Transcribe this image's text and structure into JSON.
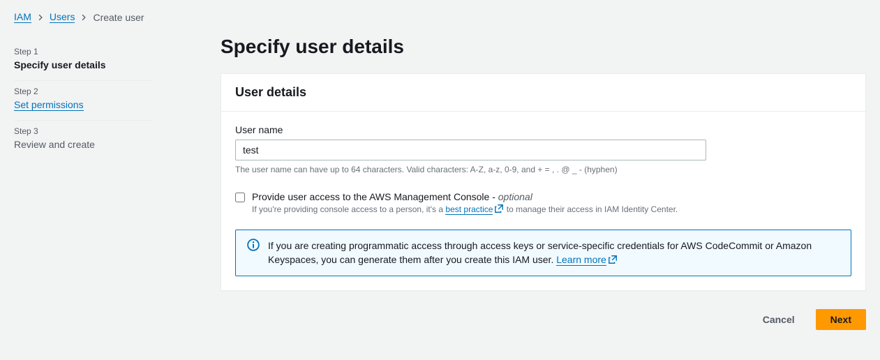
{
  "breadcrumb": {
    "items": [
      "IAM",
      "Users",
      "Create user"
    ]
  },
  "sidebar": {
    "steps": [
      {
        "num": "Step 1",
        "title": "Specify user details"
      },
      {
        "num": "Step 2",
        "title": "Set permissions"
      },
      {
        "num": "Step 3",
        "title": "Review and create"
      }
    ]
  },
  "page": {
    "title": "Specify user details"
  },
  "panel": {
    "title": "User details",
    "username_label": "User name",
    "username_value": "test",
    "username_hint": "The user name can have up to 64 characters. Valid characters: A-Z, a-z, 0-9, and + = , . @ _ - (hyphen)",
    "checkbox_label_main": "Provide user access to the AWS Management Console - ",
    "checkbox_label_optional": "optional",
    "checkbox_desc_before": "If you're providing console access to a person, it's a ",
    "checkbox_desc_link": "best practice",
    "checkbox_desc_after": " to manage their access in IAM Identity Center.",
    "info_text_before": "If you are creating programmatic access through access keys or service-specific credentials for AWS CodeCommit or Amazon Keyspaces, you can generate them after you create this IAM user. ",
    "info_link": "Learn more"
  },
  "buttons": {
    "cancel": "Cancel",
    "next": "Next"
  }
}
